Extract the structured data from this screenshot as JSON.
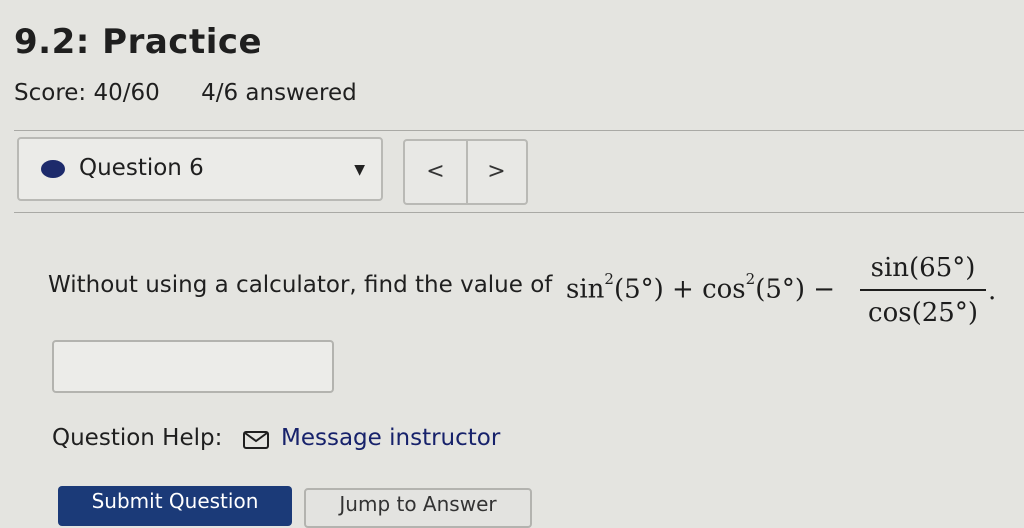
{
  "header": {
    "title": "9.2: Practice",
    "score": "Score: 40/60",
    "answered": "4/6 answered"
  },
  "question_select": {
    "label": "Question 6",
    "status_color": "#1d2a6b",
    "caret_icon": "caret-down-icon"
  },
  "nav": {
    "prev": "<",
    "next": ">"
  },
  "question": {
    "prompt": "Without using a calculator, find the value of",
    "expr_part1": "sin",
    "exp1": "2",
    "expr_part2": "(5°) + cos",
    "exp2": "2",
    "expr_part3": "(5°) −",
    "frac_num": "sin(65°)",
    "frac_den": "cos(25°)",
    "period": "."
  },
  "answer": {
    "value": ""
  },
  "help": {
    "label": "Question Help:",
    "icon": "envelope-icon",
    "link": "Message instructor"
  },
  "actions": {
    "submit": "Submit Question",
    "jump": "Jump to Answer"
  }
}
